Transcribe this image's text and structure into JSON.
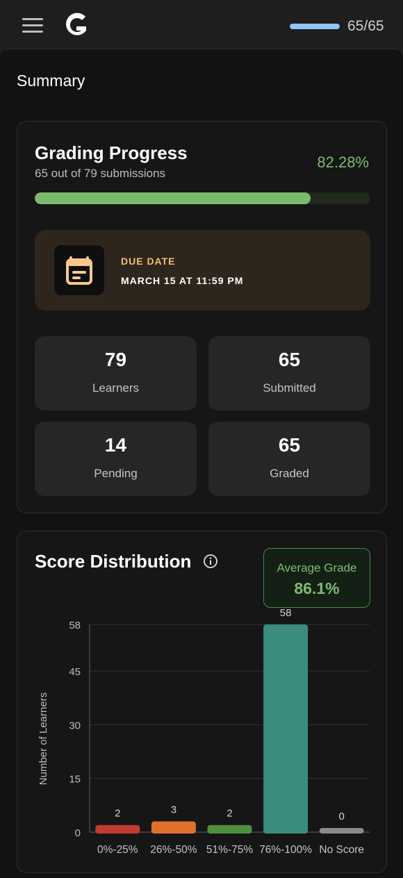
{
  "header": {
    "menu_icon": "hamburger-menu-icon",
    "logo_icon": "g-logo-icon",
    "progress_fraction": 1.0,
    "progress_label": "65/65"
  },
  "page": {
    "title": "Summary"
  },
  "grading_progress": {
    "title": "Grading Progress",
    "subtitle": "65 out of 79 submissions",
    "percent_label": "82.28%",
    "percent_value": 82.28,
    "due": {
      "icon": "calendar-icon",
      "label": "DUE DATE",
      "value": "MARCH 15 AT 11:59 PM"
    },
    "stats": [
      {
        "value": "79",
        "label": "Learners"
      },
      {
        "value": "65",
        "label": "Submitted"
      },
      {
        "value": "14",
        "label": "Pending"
      },
      {
        "value": "65",
        "label": "Graded"
      }
    ]
  },
  "score_distribution": {
    "title": "Score Distribution",
    "info_icon": "info-icon",
    "average_label": "Average Grade",
    "average_value": "86.1%"
  },
  "chart_data": {
    "type": "bar",
    "categories": [
      "0%-25%",
      "26%-50%",
      "51%-75%",
      "76%-100%",
      "No Score"
    ],
    "values": [
      2,
      3,
      2,
      58,
      0
    ],
    "ylabel": "Number of Learners",
    "xlabel": "",
    "yticks": [
      0,
      15,
      30,
      45,
      58
    ],
    "ylim": [
      0,
      58
    ],
    "grid": true,
    "colors": [
      "#c23b32",
      "#e0712c",
      "#4f8f3e",
      "#3a8c7e",
      "#8a8a8a"
    ]
  },
  "colors": {
    "accent_green": "#7dbd71",
    "accent_blue": "#8ec5f5",
    "due_accent": "#f2be7a"
  }
}
